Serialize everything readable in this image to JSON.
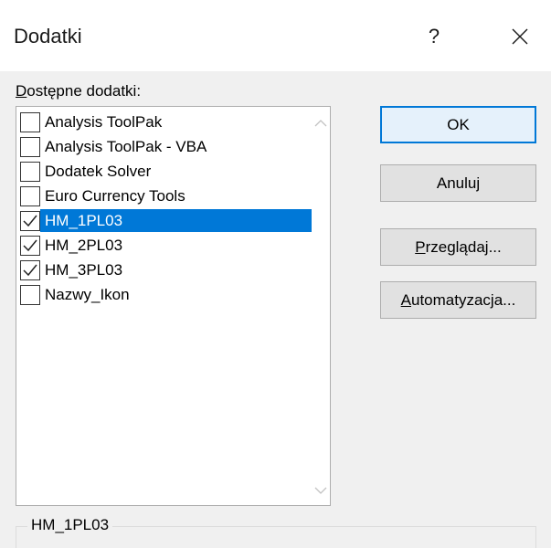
{
  "window": {
    "title": "Dodatki",
    "help_label": "?"
  },
  "addins": {
    "label_accel": "D",
    "label_rest": "ostępne dodatki:",
    "items": [
      {
        "label": "Analysis ToolPak",
        "checked": false,
        "selected": false
      },
      {
        "label": "Analysis ToolPak - VBA",
        "checked": false,
        "selected": false
      },
      {
        "label": "Dodatek Solver",
        "checked": false,
        "selected": false
      },
      {
        "label": "Euro Currency Tools",
        "checked": false,
        "selected": false
      },
      {
        "label": "HM_1PL03",
        "checked": true,
        "selected": true
      },
      {
        "label": "HM_2PL03",
        "checked": true,
        "selected": false
      },
      {
        "label": "HM_3PL03",
        "checked": true,
        "selected": false
      },
      {
        "label": "Nazwy_Ikon",
        "checked": false,
        "selected": false
      }
    ]
  },
  "buttons": {
    "ok": "OK",
    "cancel": "Anuluj",
    "browse_accel": "P",
    "browse_rest": "rzeglądaj...",
    "automation_accel": "A",
    "automation_rest": "utomatyzacja..."
  },
  "description": {
    "title": "HM_1PL03"
  },
  "colors": {
    "selection": "#0078d7",
    "default_button_border": "#0078d7"
  }
}
